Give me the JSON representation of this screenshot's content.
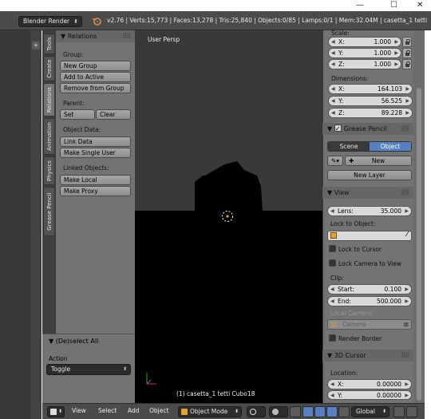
{
  "window": {
    "minimize": "—",
    "maximize": "☐",
    "close": "✕"
  },
  "header": {
    "render_engine": "Blender Render",
    "stats": "v2.76 | Verts:15,773 | Faces:13,278 | Tris:25,840 | Objects:0/85 | Lamps:0/1 | Mem:32.04M | casetta_1 tetti"
  },
  "left_tabs": [
    "Tools",
    "Create",
    "Relations",
    "Animation",
    "Physics",
    "Grease Pencil"
  ],
  "relations_panel": {
    "title": "Relations",
    "group_label": "Group:",
    "new_group": "New Group",
    "add_to_active": "Add to Active",
    "remove_from_group": "Remove from Group",
    "parent_label": "Parent:",
    "set": "Set",
    "clear": "Clear",
    "object_data_label": "Object Data:",
    "link_data": "Link Data",
    "make_single_user": "Make Single User",
    "linked_objects_label": "Linked Objects:",
    "make_local": "Make Local",
    "make_proxy": "Make Proxy"
  },
  "operator_panel": {
    "title": "(De)select All",
    "action_label": "Action",
    "action_value": "Toggle"
  },
  "viewport": {
    "view_name": "User Persp",
    "object_info": "(1) casetta_1 tetti Cubo18"
  },
  "properties": {
    "scale_label": "Scale:",
    "scale": [
      {
        "axis": "X:",
        "value": "1.000"
      },
      {
        "axis": "Y:",
        "value": "1.000"
      },
      {
        "axis": "Z:",
        "value": "1.000"
      }
    ],
    "dimensions_label": "Dimensions:",
    "dimensions": [
      {
        "axis": "X:",
        "value": "164.103"
      },
      {
        "axis": "Y:",
        "value": "56.525"
      },
      {
        "axis": "Z:",
        "value": "89.228"
      }
    ],
    "grease_pencil": {
      "title": "Grease Pencil",
      "scene": "Scene",
      "object": "Object",
      "new": "New",
      "new_layer": "New Layer"
    },
    "view": {
      "title": "View",
      "lens_label": "Lens:",
      "lens_value": "35.000",
      "lock_to_object_label": "Lock to Object:",
      "lock_to_cursor": "Lock to Cursor",
      "lock_camera_to_view": "Lock Camera to View",
      "clip_label": "Clip:",
      "clip_start_label": "Start:",
      "clip_start_value": "0.100",
      "clip_end_label": "End:",
      "clip_end_value": "500.000",
      "local_camera_label": "Local Camera:",
      "local_camera_value": "Camera",
      "render_border": "Render Border"
    },
    "cursor": {
      "title": "3D Cursor",
      "location_label": "Location:",
      "x_label": "X:",
      "x_value": "0.00000",
      "y_label": "Y:",
      "y_value": "0.00000"
    }
  },
  "bottom_bar": {
    "view": "View",
    "select": "Select",
    "add": "Add",
    "object": "Object",
    "mode": "Object Mode",
    "orientation": "Global"
  },
  "colors": {
    "accent_blue": "#5680c2",
    "panel_gray": "#737373",
    "header_dark": "#4b4b4b",
    "viewport_bg": "#393939"
  }
}
